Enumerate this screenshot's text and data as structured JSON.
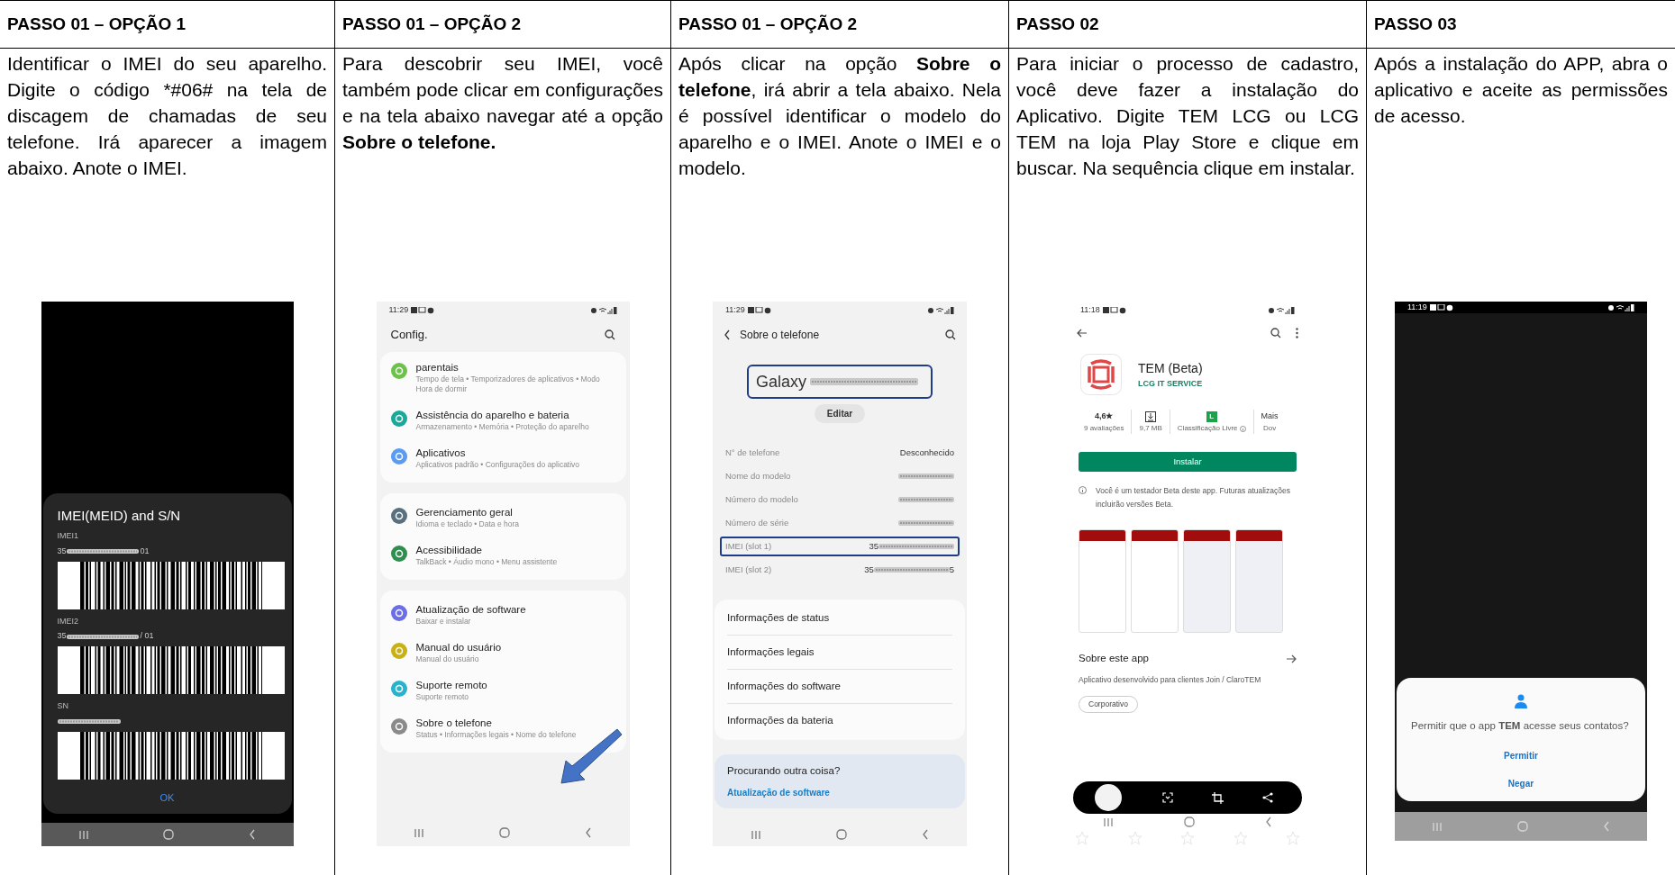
{
  "steps": [
    {
      "heading": "PASSO 01 – OPÇÃO 1",
      "text": "Identificar o IMEI do seu aparelho. Digite o código *#06# na tela de discagem de chamadas de seu telefone. Irá aparecer a imagem abaixo. Anote o IMEI.",
      "screen": {
        "kind": "imei_dialog",
        "title": "IMEI(MEID) and S/N",
        "entries": [
          {
            "label": "IMEI1",
            "value_start": "35",
            "value_end": "01"
          },
          {
            "label": "IMEI2",
            "value_start": "35",
            "value_end": "/ 01"
          },
          {
            "label": "SN"
          }
        ],
        "button": "OK"
      }
    },
    {
      "heading": "PASSO 01 – OPÇÃO 2",
      "text": "Para descobrir seu IMEI, você também pode clicar em configurações e na tela abaixo navegar até a opção **Sobre o telefone.**",
      "screen": {
        "kind": "settings_list",
        "time": "11:29",
        "title": "Config.",
        "groups": [
          [
            {
              "title": "parentais",
              "subtitle": "Tempo de tela • Temporizadores de aplicativos • Modo Hora de dormir",
              "color": "#6cc24a"
            },
            {
              "title": "Assistência do aparelho e bateria",
              "subtitle": "Armazenamento • Memória • Proteção do aparelho",
              "color": "#1aa89a"
            },
            {
              "title": "Aplicativos",
              "subtitle": "Aplicativos padrão • Configurações do aplicativo",
              "color": "#5b9cf2"
            }
          ],
          [
            {
              "title": "Gerenciamento geral",
              "subtitle": "Idioma e teclado • Data e hora",
              "color": "#58707f"
            },
            {
              "title": "Acessibilidade",
              "subtitle": "TalkBack • Áudio mono • Menu assistente",
              "color": "#2f8f4e"
            }
          ],
          [
            {
              "title": "Atualização de software",
              "subtitle": "Baixar e instalar",
              "color": "#6b6fe6"
            },
            {
              "title": "Manual do usuário",
              "subtitle": "Manual do usuário",
              "color": "#c8b015"
            },
            {
              "title": "Suporte remoto",
              "subtitle": "Suporte remoto",
              "color": "#28b3cc"
            },
            {
              "title": "Sobre o telefone",
              "subtitle": "Status • Informações legais • Nome do telefone",
              "color": "#8a8a8a"
            }
          ]
        ]
      }
    },
    {
      "heading": "PASSO 01 – OPÇÃO 2",
      "text": "Após clicar na opção **Sobre o telefone**, irá abrir a tela abaixo. Nela é possível identificar o modelo do aparelho e o IMEI. Anote o IMEI e o modelo.",
      "screen": {
        "kind": "about_phone",
        "time": "11:29",
        "title": "Sobre o telefone",
        "device": {
          "name": "Galaxy",
          "highlighted": true
        },
        "edit_button": "Editar",
        "rows": [
          {
            "label": "N° de telefone",
            "value_start": "Desconhecido",
            "redacted": false,
            "highlighted": false
          },
          {
            "label": "Nome do modelo",
            "redacted": true,
            "highlighted": false
          },
          {
            "label": "Número do modelo",
            "redacted": true,
            "highlighted": false
          },
          {
            "label": "Número de série",
            "redacted": true,
            "highlighted": false
          },
          {
            "label": "IMEI (slot 1)",
            "value_start": "35",
            "redacted": true,
            "highlighted": true
          },
          {
            "label": "IMEI (slot 2)",
            "value_start": "35",
            "value_end": "5",
            "redacted": true,
            "highlighted": false
          }
        ],
        "menu": [
          "Informações de status",
          "Informações legais",
          "Informações do software",
          "Informações da bateria"
        ],
        "suggestion": {
          "title": "Procurando outra coisa?",
          "link": "Atualização de software"
        }
      }
    },
    {
      "heading": "PASSO 02",
      "text": "Para iniciar o processo de cadastro, você deve fazer a instalação do Aplicativo. Digite TEM LCG ou LCG TEM na loja Play Store e clique em buscar. Na sequência clique em instalar.",
      "screen": {
        "kind": "store_page",
        "time": "11:18",
        "app_name": "TEM (Beta)",
        "developer": "LCG IT SERVICE",
        "stats": [
          {
            "kind": "rating",
            "value": "4,6★",
            "label": "9 avaliações"
          },
          {
            "kind": "size",
            "label": "9,7 MB"
          },
          {
            "kind": "content_rating",
            "value": "L",
            "label": "Classificação Livre"
          },
          {
            "kind": "text",
            "value": "Mais",
            "label": "Dov"
          }
        ],
        "install_button": "Instalar",
        "notice": "Você é um testador Beta deste app. Futuras atualizações incluirão versões Beta.",
        "about_title": "Sobre este app",
        "description": "Aplicativo desenvolvido para clientes Join / ClaroTEM",
        "tag": "Corporativo",
        "stars": 0
      }
    },
    {
      "heading": "PASSO 03",
      "text": "Após a instalação do APP, abra o aplicativo e aceite as permissões de acesso.",
      "screen": {
        "kind": "permission_dialog",
        "time": "11:19",
        "message": "Permitir que o app **TEM** acesse seus contatos?",
        "buttons": [
          "Permitir",
          "Negar"
        ]
      }
    }
  ]
}
